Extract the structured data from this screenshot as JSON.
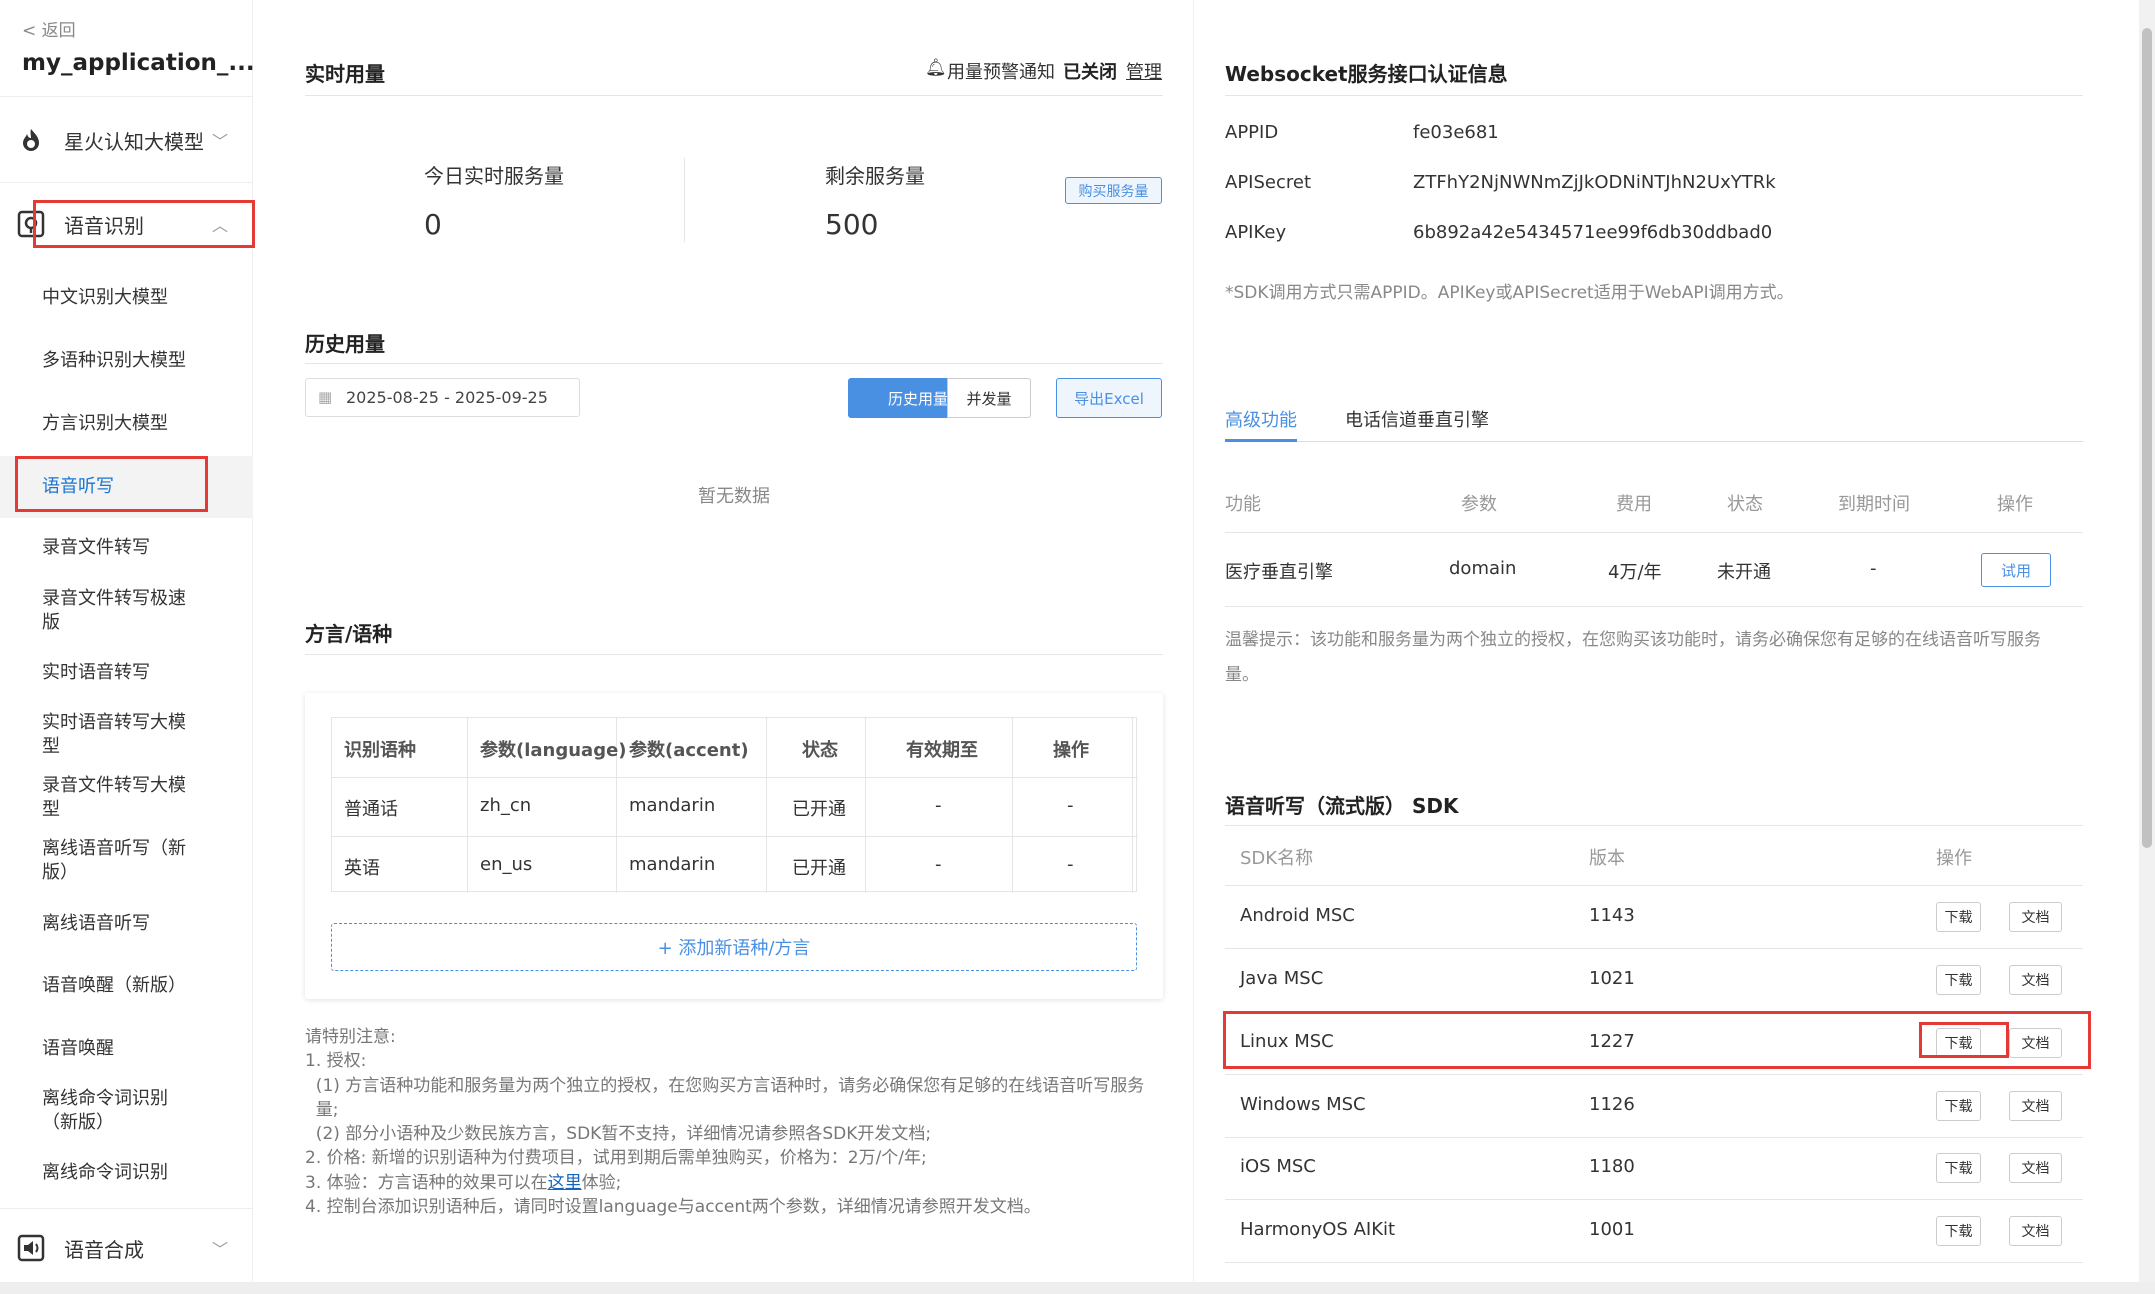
{
  "sidebar": {
    "back_label": "< 返回",
    "app_name": "my_application_...",
    "group1": "星火认知大模型",
    "group2": "语音识别",
    "sub_items": [
      "中文识别大模型",
      "多语种识别大模型",
      "方言识别大模型",
      "语音听写",
      "录音文件转写",
      "录音文件转写极速版",
      "实时语音转写",
      "实时语音转写大模型",
      "录音文件转写大模型",
      "离线语音听写（新版）",
      "离线语音听写",
      "语音唤醒（新版）",
      "语音唤醒",
      "离线命令词识别（新版）",
      "离线命令词识别"
    ],
    "group3": "语音合成"
  },
  "realtime": {
    "title": "实时用量",
    "alert_label": "用量预警通知",
    "alert_status": "已关闭",
    "manage_label": "管理",
    "today_label": "今日实时服务量",
    "today_value": "0",
    "remaining_label": "剩余服务量",
    "remaining_value": "500",
    "buy_label": "购买服务量"
  },
  "history": {
    "title": "历史用量",
    "date_range": "2025-08-25  - 2025-09-25",
    "tab_history": "历史用量",
    "tab_concurrent": "并发量",
    "export_label": "导出Excel",
    "empty": "暂无数据"
  },
  "dialect": {
    "title": "方言/语种",
    "headers": [
      "识别语种",
      "参数(language)",
      "参数(accent)",
      "状态",
      "有效期至",
      "操作"
    ],
    "rows": [
      [
        "普通话",
        "zh_cn",
        "mandarin",
        "已开通",
        "-",
        "-"
      ],
      [
        "英语",
        "en_us",
        "mandarin",
        "已开通",
        "-",
        "-"
      ]
    ],
    "add_label": "+ 添加新语种/方言"
  },
  "notes": {
    "lines": [
      "请特别注意:",
      "1. 授权:",
      "  (1) 方言语种功能和服务量为两个独立的授权，在您购买方言语种时，请务必确保您有足够的在线语音听写服务",
      "  量;",
      "  (2) 部分小语种及少数民族方言，SDK暂不支持，详细情况请参照各SDK开发文档;",
      "2. 价格: 新增的识别语种为付费项目，试用到期后需单独购买，价格为：2万/个/年;",
      "3. 体验：方言语种的效果可以在",
      "4. 控制台添加识别语种后，请同时设置language与accent两个参数，详细情况请参照开发文档。"
    ],
    "link_text": "这里",
    "link_suffix": "体验;"
  },
  "websocket": {
    "title": "Websocket服务接口认证信息",
    "appid_label": "APPID",
    "appid": "fe03e681",
    "apisecret_label": "APISecret",
    "apisecret": "ZTFhY2NjNWNmZjJkODNiNTJhN2UxYTRk",
    "apikey_label": "APIKey",
    "apikey": "6b892a42e5434571ee99f6db30ddbad0",
    "note": "*SDK调用方式只需APPID。APIKey或APISecret适用于WebAPI调用方式。"
  },
  "advanced": {
    "tab1": "高级功能",
    "tab2": "电话信道垂直引擎",
    "headers": [
      "功能",
      "参数",
      "费用",
      "状态",
      "到期时间",
      "操作"
    ],
    "row": [
      "医疗垂直引擎",
      "domain",
      "4万/年",
      "未开通",
      "-"
    ],
    "try_label": "试用",
    "tip_line1": "温馨提示：该功能和服务量为两个独立的授权，在您购买该功能时，请务必确保您有足够的在线语音听写服务",
    "tip_line2": "量。"
  },
  "sdk": {
    "title": "语音听写（流式版） SDK",
    "headers": [
      "SDK名称",
      "版本",
      "操作"
    ],
    "download_label": "下载",
    "doc_label": "文档",
    "rows": [
      {
        "name": "Android MSC",
        "version": "1143"
      },
      {
        "name": "Java MSC",
        "version": "1021"
      },
      {
        "name": "Linux MSC",
        "version": "1227"
      },
      {
        "name": "Windows MSC",
        "version": "1126"
      },
      {
        "name": "iOS MSC",
        "version": "1180"
      },
      {
        "name": "HarmonyOS AIKit",
        "version": "1001"
      }
    ]
  },
  "colors": {
    "accent": "#1976d2",
    "highlight": "#e53935",
    "link": "#1565c0"
  }
}
